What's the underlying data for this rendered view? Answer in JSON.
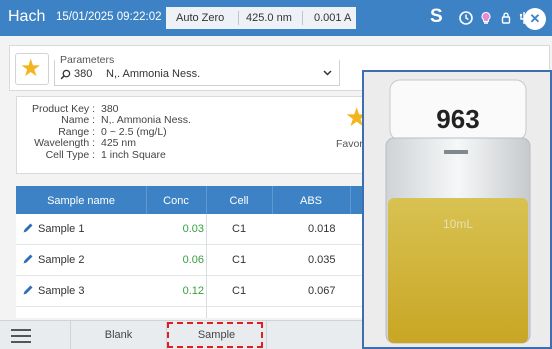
{
  "header": {
    "brand": "Hach",
    "datetime": "15/01/2025 09:22:02",
    "auto_zero": "Auto Zero",
    "wavelength": "425.0 nm",
    "absorbance": "0.001 A",
    "s_label": "S",
    "icons": [
      "clock-icon",
      "lightbulb-icon",
      "lock-icon",
      "usb-icon",
      "close-icon"
    ]
  },
  "parameters": {
    "label": "Parameters",
    "number": "380",
    "name": "N,. Ammonia Ness."
  },
  "product": {
    "keys": [
      "Product Key :",
      "Name :",
      "Range :",
      "Wavelength :",
      "Cell Type :"
    ],
    "values": [
      "380",
      "N,. Ammonia Ness.",
      "0 ~ 2.5 (mg/L)",
      "425 nm",
      "1 inch Square"
    ],
    "favorite_label": "Favorit"
  },
  "table": {
    "headers": [
      "Sample name",
      "Conc",
      "Cell",
      "ABS"
    ],
    "rows": [
      {
        "name": "Sample 1",
        "conc": "0.03",
        "cell": "C1",
        "abs": "0.018"
      },
      {
        "name": "Sample 2",
        "conc": "0.06",
        "cell": "C1",
        "abs": "0.035"
      },
      {
        "name": "Sample 3",
        "conc": "0.12",
        "cell": "C1",
        "abs": "0.067"
      }
    ]
  },
  "bottom": {
    "tabs": [
      "Blank",
      "Sample"
    ]
  },
  "photo": {
    "cap_number": "963",
    "vial_marking": "10mL"
  },
  "colors": {
    "primary": "#3d82c5",
    "favorite": "#f2b51d",
    "conc_text": "#35a13c",
    "focus_outline": "#e02020"
  }
}
